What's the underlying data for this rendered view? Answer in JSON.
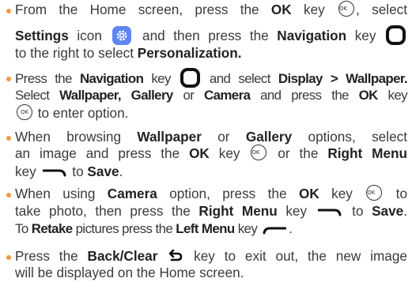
{
  "instructions": [
    {
      "lines": [
        [
          "From the Home screen, press the ",
          {
            "b": "OK"
          },
          " key ",
          {
            "icon": "ok"
          },
          ", select"
        ],
        [
          {
            "b": "Settings"
          },
          " icon ",
          {
            "icon": "settings"
          },
          " and then press the ",
          {
            "b": "Navigation"
          },
          " key ",
          {
            "icon": "nav"
          }
        ],
        [
          "to the right to select ",
          {
            "b": "Personalization."
          }
        ]
      ]
    },
    {
      "lines": [
        [
          "Press the ",
          {
            "b": "Navigation"
          },
          " key ",
          {
            "icon": "nav"
          },
          " and select ",
          {
            "b": "Display > Wallpaper."
          }
        ],
        [
          "Select ",
          {
            "b": "Wallpaper, Gallery"
          },
          " or ",
          {
            "b": "Camera"
          },
          " and press the ",
          {
            "b": "OK"
          },
          " key"
        ],
        [
          {
            "icon": "ok"
          },
          " to enter option."
        ]
      ]
    },
    {
      "lines": [
        [
          "When browsing ",
          {
            "b": "Wallpaper"
          },
          " or ",
          {
            "b": "Gallery"
          },
          " options, select"
        ],
        [
          "an image and press the ",
          {
            "b": "OK"
          },
          " key ",
          {
            "icon": "ok"
          },
          " or the ",
          {
            "b": "Right Menu"
          }
        ],
        [
          "key ",
          {
            "icon": "right-menu"
          },
          " to ",
          {
            "b": "Save"
          },
          "."
        ]
      ]
    },
    {
      "lines": [
        [
          "When using ",
          {
            "b": "Camera"
          },
          " option, press the ",
          {
            "b": "OK"
          },
          " key ",
          {
            "icon": "ok"
          },
          " to"
        ],
        [
          "take photo, then press the ",
          {
            "b": "Right Menu"
          },
          " key ",
          {
            "icon": "right-menu"
          },
          " to ",
          {
            "b": "Save"
          },
          "."
        ],
        [
          "To ",
          {
            "b": "Retake"
          },
          " pictures press the ",
          {
            "b": "Left Menu"
          },
          " key ",
          {
            "icon": "left-menu"
          },
          "."
        ]
      ]
    },
    {
      "lines": [
        [
          "Press the ",
          {
            "b": "Back/Clear"
          },
          " ",
          {
            "icon": "back"
          },
          " key to exit out, the new image"
        ],
        [
          "will be displayed on the Home screen."
        ]
      ]
    }
  ],
  "icons": {
    "ok": {
      "name": "ok-key-icon",
      "label": "OK"
    },
    "settings": {
      "name": "settings-gear-icon",
      "color": "#5f86f0"
    },
    "nav": {
      "name": "navigation-key-icon"
    },
    "right-menu": {
      "name": "right-menu-key-icon"
    },
    "left-menu": {
      "name": "left-menu-key-icon"
    },
    "back": {
      "name": "back-clear-key-icon"
    }
  },
  "colors": {
    "bullet": "#f29a3d",
    "text": "#3a3a3a"
  }
}
